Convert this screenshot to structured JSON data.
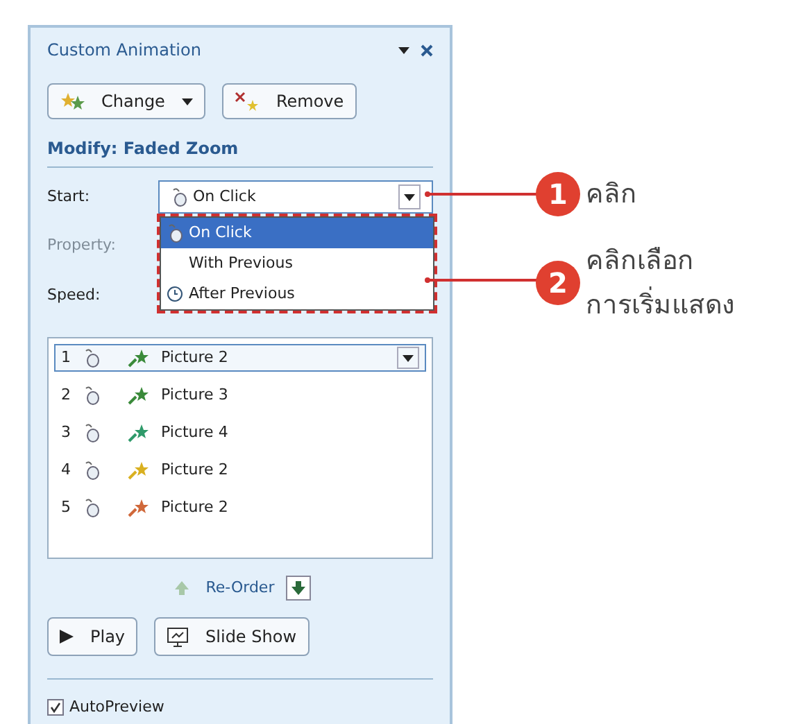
{
  "panel": {
    "title": "Custom Animation",
    "buttons": [
      {
        "kind": "change",
        "label": "Change"
      },
      {
        "kind": "remove",
        "label": "Remove"
      }
    ],
    "heading": "Modify: Faded Zoom",
    "start": {
      "label": "Start:",
      "value": "On Click",
      "expanded": true
    },
    "property": {
      "label": "Property:",
      "disabled": true
    },
    "speed": {
      "label": "Speed:"
    },
    "start_options": [
      {
        "label": "On Click",
        "selected": true,
        "kind": "click"
      },
      {
        "label": "With Previous",
        "selected": false,
        "kind": "with"
      },
      {
        "label": "After Previous",
        "selected": false,
        "kind": "after"
      }
    ],
    "effects": [
      {
        "number": "1",
        "name": "Picture 2",
        "selected": true,
        "color": "#3a8a3a"
      },
      {
        "number": "2",
        "name": "Picture 3",
        "selected": false,
        "color": "#3a8a3a"
      },
      {
        "number": "3",
        "name": "Picture 4",
        "selected": false,
        "color": "#2f9a6a"
      },
      {
        "number": "4",
        "name": "Picture 2",
        "selected": false,
        "color": "#d9b020"
      },
      {
        "number": "5",
        "name": "Picture 2",
        "selected": false,
        "color": "#d0683a"
      }
    ],
    "reorder": "Re-Order",
    "actions": [
      {
        "kind": "play",
        "label": "Play"
      },
      {
        "kind": "slideshow",
        "label": "Slide Show"
      }
    ],
    "autopreview": {
      "label": "AutoPreview",
      "checked": true
    }
  },
  "callouts": [
    {
      "number": "1",
      "lines": [
        "คลิก"
      ]
    },
    {
      "number": "2",
      "lines": [
        "คลิกเลือก",
        "การเริ่มแสดง"
      ]
    }
  ]
}
